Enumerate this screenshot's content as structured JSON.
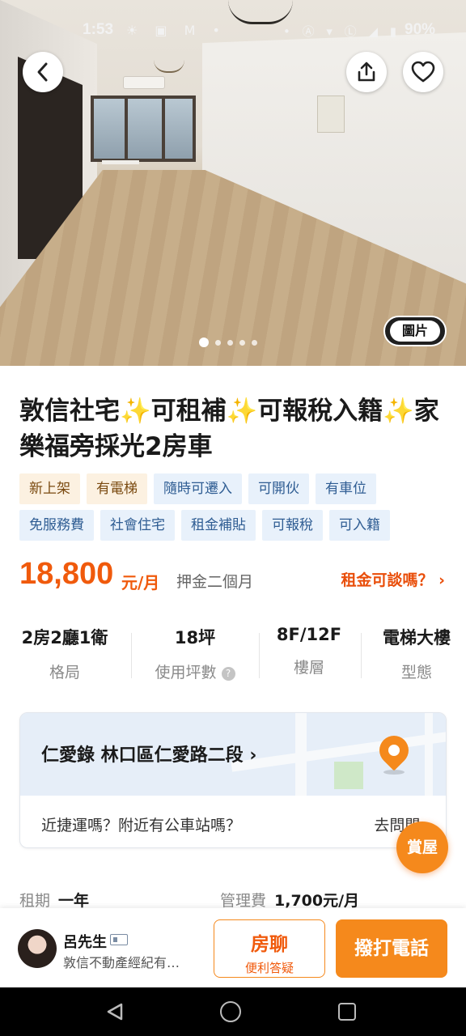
{
  "status_bar": {
    "time": "1:53",
    "left_icons": "☀ ▣ M •",
    "right_icons": "• Ⓐ ▾ Ⓛ ◢ ▮",
    "battery": "90%"
  },
  "hero": {
    "photo_button_label": "圖片",
    "carousel_count": 5,
    "carousel_active": 0
  },
  "listing": {
    "title": "敦信社宅✨可租補✨可報稅入籍✨家樂福旁採光2房車",
    "tags_row1": [
      "新上架",
      "有電梯",
      "隨時可遷入",
      "可開伙",
      "有車位"
    ],
    "tags_row2": [
      "免服務費",
      "社會住宅",
      "租金補貼",
      "可報稅",
      "可入籍"
    ],
    "price": "18,800",
    "price_unit": "元/月",
    "deposit": "押金二個月",
    "negotiate": "租金可談嗎？ ›"
  },
  "stats": [
    {
      "value": "2房2廳1衛",
      "label": "格局"
    },
    {
      "value": "18坪",
      "label": "使用坪數"
    },
    {
      "value": "8F/12F",
      "label": "樓層"
    },
    {
      "value": "電梯大樓",
      "label": "型態"
    }
  ],
  "address": {
    "text": "仁愛錄 林口區仁愛路二段 ›",
    "question": "近捷運嗎？附近有公車站嗎？",
    "ask_link": "去問問 ›"
  },
  "floating": {
    "view_label": "賞屋"
  },
  "info": {
    "term_key": "租期",
    "term_value": "一年",
    "fee_key": "管理費",
    "fee_value": "1,700元/月"
  },
  "agent": {
    "name": "呂先生",
    "company": "敦信不動產經紀有…"
  },
  "actions": {
    "chat_title": "房聊",
    "chat_sub": "便利答疑",
    "call_label": "撥打電話"
  },
  "colors": {
    "accent": "#f5891c",
    "price": "#f05a0c"
  }
}
